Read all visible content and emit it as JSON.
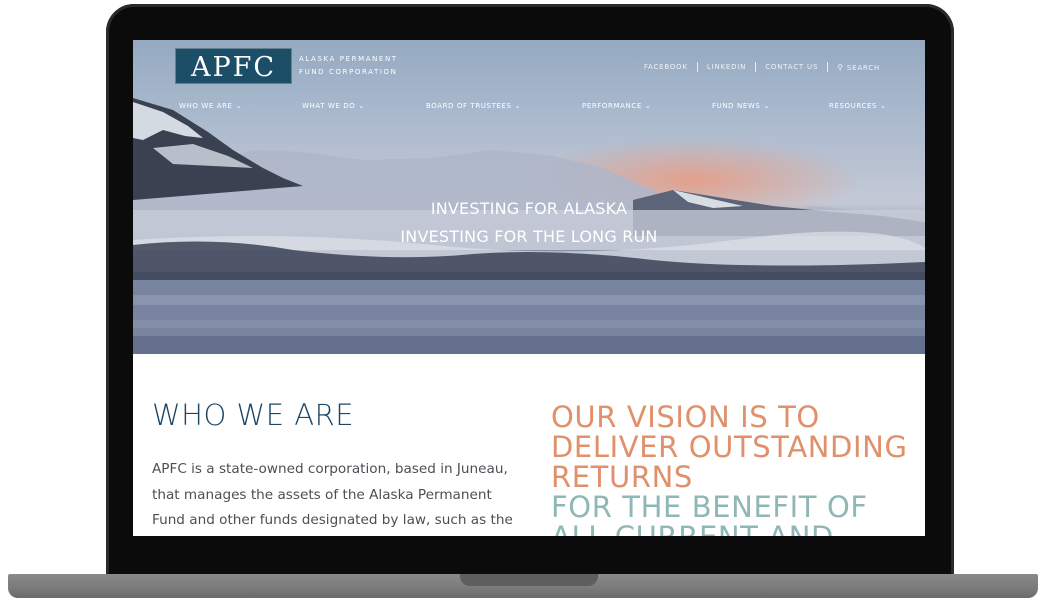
{
  "logo": {
    "mark": "APFC",
    "line1": "ALASKA PERMANENT",
    "line2": "FUND CORPORATION"
  },
  "top_links": {
    "facebook": "FACEBOOK",
    "linkedin": "LINKEDIN",
    "contact": "CONTACT US",
    "search": "SEARCH"
  },
  "nav": [
    {
      "label": "WHO WE ARE"
    },
    {
      "label": "WHAT WE DO"
    },
    {
      "label": "BOARD OF TRUSTEES"
    },
    {
      "label": "PERFORMANCE"
    },
    {
      "label": "FUND NEWS"
    },
    {
      "label": "RESOURCES"
    }
  ],
  "hero": {
    "line1": "INVESTING FOR ALASKA",
    "line2": "INVESTING FOR THE LONG RUN"
  },
  "who": {
    "title": "WHO WE ARE",
    "body": "APFC is a state-owned corporation, based in Juneau, that manages the assets of the Alaska Permanent Fund and other funds designated by law, such as the Alaska Mental Health Trust Fund."
  },
  "vision": {
    "line1": "OUR VISION IS TO",
    "line2": "DELIVER OUTSTANDING",
    "line3": "RETURNS",
    "line4": "FOR THE BENEFIT OF",
    "line5": "ALL CURRENT AND"
  },
  "colors": {
    "brand_navy": "#1d4e67",
    "heading_navy": "#1d4664",
    "accent_orange": "#e0906b",
    "accent_teal": "#8fb7b5"
  },
  "icons": {
    "search": "search-icon",
    "nav_dropdown": "chevron-down-icon"
  }
}
